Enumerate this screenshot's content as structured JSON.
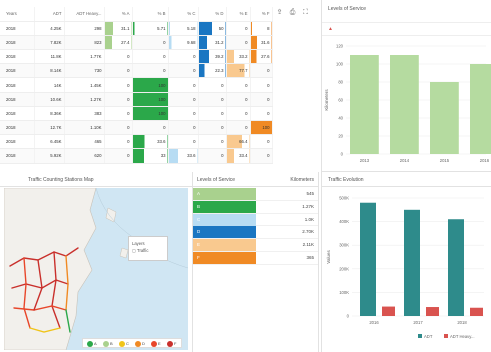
{
  "table": {
    "columns": [
      "Years",
      "ADT",
      "ADT Heavy...",
      "% A",
      "% B",
      "% C",
      "% D",
      "% E",
      "% F"
    ],
    "rows": [
      {
        "year": "2018",
        "adt": "4.25K",
        "heavy": "298",
        "a": "31.1",
        "b": "5.71",
        "c": "5.18",
        "d": "50",
        "e": "0",
        "f": "8",
        "a_pct": 31.1,
        "b_pct": 5.71,
        "c_pct": 5.18,
        "d_pct": 50,
        "e_pct": 0,
        "f_pct": 8
      },
      {
        "year": "2018",
        "adt": "7.82K",
        "heavy": "823",
        "a": "27.4",
        "b": "0",
        "c": "9.68",
        "d": "31.2",
        "e": "0",
        "f": "31.6",
        "a_pct": 27.4,
        "b_pct": 0,
        "c_pct": 9.68,
        "d_pct": 31.2,
        "e_pct": 0,
        "f_pct": 31.6
      },
      {
        "year": "2018",
        "adt": "11.8K",
        "heavy": "1.77K",
        "a": "0",
        "b": "0",
        "c": "0",
        "d": "39.2",
        "e": "33.2",
        "f": "27.6",
        "a_pct": 0,
        "b_pct": 0,
        "c_pct": 0,
        "d_pct": 39.2,
        "e_pct": 33.2,
        "f_pct": 27.6
      },
      {
        "year": "2018",
        "adt": "8.14K",
        "heavy": "730",
        "a": "0",
        "b": "0",
        "c": "0",
        "d": "22.3",
        "e": "77.7",
        "f": "0",
        "a_pct": 0,
        "b_pct": 0,
        "c_pct": 0,
        "d_pct": 22.3,
        "e_pct": 77.7,
        "f_pct": 0
      },
      {
        "year": "2018",
        "adt": "14K",
        "heavy": "1.45K",
        "a": "0",
        "b": "100",
        "c": "0",
        "d": "0",
        "e": "0",
        "f": "0",
        "a_pct": 0,
        "b_pct": 100,
        "c_pct": 0,
        "d_pct": 0,
        "e_pct": 0,
        "f_pct": 0
      },
      {
        "year": "2018",
        "adt": "10.6K",
        "heavy": "1.27K",
        "a": "0",
        "b": "100",
        "c": "0",
        "d": "0",
        "e": "0",
        "f": "0",
        "a_pct": 0,
        "b_pct": 100,
        "c_pct": 0,
        "d_pct": 0,
        "e_pct": 0,
        "f_pct": 0
      },
      {
        "year": "2018",
        "adt": "8.36K",
        "heavy": "383",
        "a": "0",
        "b": "100",
        "c": "0",
        "d": "0",
        "e": "0",
        "f": "0",
        "a_pct": 0,
        "b_pct": 100,
        "c_pct": 0,
        "d_pct": 0,
        "e_pct": 0,
        "f_pct": 0
      },
      {
        "year": "2018",
        "adt": "12.7K",
        "heavy": "1.10K",
        "a": "0",
        "b": "0",
        "c": "0",
        "d": "0",
        "e": "0",
        "f": "100",
        "a_pct": 0,
        "b_pct": 0,
        "c_pct": 0,
        "d_pct": 0,
        "e_pct": 0,
        "f_pct": 100
      },
      {
        "year": "2018",
        "adt": "6.45K",
        "heavy": "465",
        "a": "0",
        "b": "33.6",
        "c": "0",
        "d": "0",
        "e": "66.4",
        "f": "0",
        "a_pct": 0,
        "b_pct": 33.6,
        "c_pct": 0,
        "d_pct": 0,
        "e_pct": 66.4,
        "f_pct": 0
      },
      {
        "year": "2018",
        "adt": "5.92K",
        "heavy": "620",
        "a": "0",
        "b": "33",
        "c": "33.6",
        "d": "0",
        "e": "33.4",
        "f": "0",
        "a_pct": 0,
        "b_pct": 33,
        "c_pct": 33.6,
        "d_pct": 0,
        "e_pct": 33.4,
        "f_pct": 0
      }
    ]
  },
  "colors": {
    "A": "#a9d18e",
    "B": "#2ba84a",
    "C": "#b7dcf3",
    "D": "#1a76c2",
    "E": "#f9c98f",
    "F": "#f08a24",
    "adt": "#2e8b8b",
    "adt_heavy": "#d9534f",
    "los_bar": "#b5dba0"
  },
  "toolbar": {
    "icons": [
      "export-icon",
      "print-icon",
      "fullscreen-icon"
    ]
  },
  "los_chart": {
    "header": "Levels of Service",
    "filter_marker": "▲",
    "chart_data": {
      "type": "bar",
      "categories": [
        "2013",
        "2014",
        "2015",
        "2016"
      ],
      "values": [
        110,
        110,
        80,
        100
      ],
      "ylabel": "Kilometers",
      "ylim": [
        0,
        120
      ],
      "yticks": [
        "0",
        "20",
        "40",
        "60",
        "80",
        "100",
        "120"
      ]
    }
  },
  "map": {
    "title": "Traffic Counting Stations Map",
    "layers_title": "Layers",
    "layers_item": "Traffic",
    "legend": [
      {
        "label": "A",
        "color": "#2ba84a"
      },
      {
        "label": "B",
        "color": "#a9d18e"
      },
      {
        "label": "C",
        "color": "#f0c419"
      },
      {
        "label": "D",
        "color": "#f08a24"
      },
      {
        "label": "E",
        "color": "#e8462a"
      },
      {
        "label": "F",
        "color": "#c9302c"
      }
    ]
  },
  "los_list": {
    "header_left": "Levels of Service",
    "header_right": "Kilometers",
    "rows": [
      {
        "letter": "A",
        "value": "545"
      },
      {
        "letter": "B",
        "value": "1.27K"
      },
      {
        "letter": "C",
        "value": "1.0K"
      },
      {
        "letter": "D",
        "value": "2.70K"
      },
      {
        "letter": "E",
        "value": "2.11K"
      },
      {
        "letter": "F",
        "value": "365"
      }
    ]
  },
  "evolution": {
    "title": "Traffic Evolution",
    "chart_data": {
      "type": "bar",
      "categories": [
        "2016",
        "2017",
        "2018"
      ],
      "series": [
        {
          "name": "ADT",
          "values": [
            480000,
            450000,
            410000
          ]
        },
        {
          "name": "ADT Heavy...",
          "values": [
            40000,
            38000,
            35000
          ]
        }
      ],
      "ylabel": "Values",
      "ylim": [
        0,
        500000
      ],
      "yticks": [
        "0",
        "100K",
        "200K",
        "300K",
        "400K",
        "500K"
      ],
      "legend": "bottom"
    }
  }
}
